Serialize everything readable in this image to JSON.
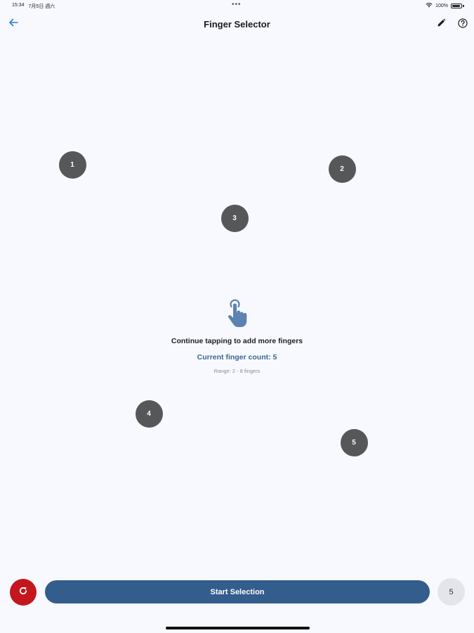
{
  "status_bar": {
    "time": "15:34",
    "date": "7月5日 週六",
    "dots": "•••",
    "battery": "100%"
  },
  "app_bar": {
    "title": "Finger Selector",
    "back_icon": "arrow-left-icon",
    "edit_icon": "pencil-icon",
    "help_icon": "help-circle-icon"
  },
  "fingers": [
    {
      "label": "1"
    },
    {
      "label": "2"
    },
    {
      "label": "3"
    },
    {
      "label": "4"
    },
    {
      "label": "5"
    }
  ],
  "center": {
    "icon": "touch-tap-icon",
    "instruction": "Continue tapping to add more fingers",
    "count_text": "Current finger count: 5",
    "range_text": "Range: 2 - 8 fingers"
  },
  "bottom": {
    "reset_icon": "refresh-icon",
    "start_label": "Start Selection",
    "count_badge": "5"
  },
  "colors": {
    "background": "#f7f9fe",
    "accent": "#335d8d",
    "finger": "#565758",
    "reset": "#c4161c",
    "back_arrow": "#2f7ad6"
  }
}
